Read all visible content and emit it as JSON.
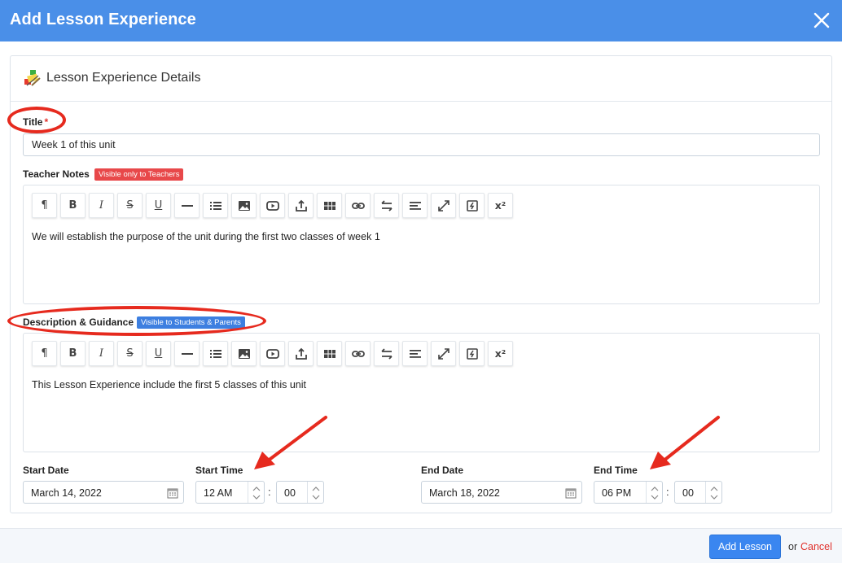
{
  "dialog": {
    "title": "Add Lesson Experience"
  },
  "card": {
    "title": "Lesson Experience Details"
  },
  "form": {
    "title_label": "Title",
    "title_required_mark": "*",
    "title_value": "Week 1 of this unit",
    "teacher_notes_label": "Teacher Notes",
    "teacher_notes_badge": "Visible only to Teachers",
    "teacher_notes_text": "We will establish the purpose of the unit during the first two classes of week 1",
    "description_label": "Description & Guidance",
    "description_badge": "Visible to Students & Parents",
    "description_text": "This Lesson Experience include the first 5 classes of this unit",
    "start_date_label": "Start Date",
    "start_date_value": "March 14, 2022",
    "start_time_label": "Start Time",
    "start_hour_value": "12 AM",
    "start_minute_value": "00",
    "end_date_label": "End Date",
    "end_date_value": "March 18, 2022",
    "end_time_label": "End Time",
    "end_hour_value": "06 PM",
    "end_minute_value": "00",
    "time_separator": ":"
  },
  "toolbar": {
    "paragraph": "¶",
    "bold": "B",
    "italic": "I",
    "strike": "S",
    "underline": "U",
    "superscript": "x²"
  },
  "footer": {
    "add_label": "Add Lesson",
    "or_text": "or",
    "cancel_label": "Cancel"
  },
  "colors": {
    "header_bg": "#4a8fe8",
    "annotation_red": "#e62a1e",
    "badge_red": "#e8484a",
    "badge_blue": "#3d7fe0",
    "primary_button": "#3a86f0"
  }
}
